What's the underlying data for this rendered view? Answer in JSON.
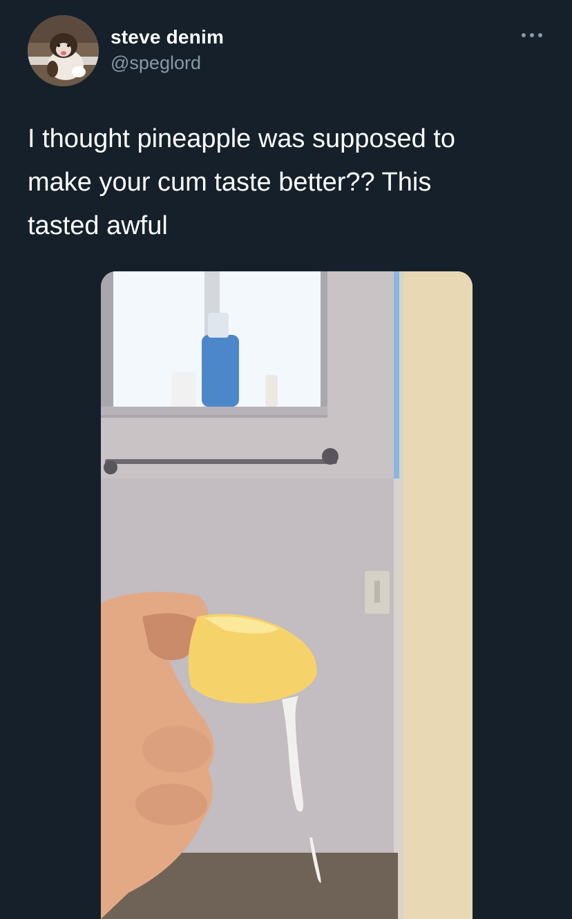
{
  "author": {
    "display_name": "steve denim",
    "handle": "@speglord",
    "avatar_icon": "dog-avatar-icon"
  },
  "tweet": {
    "text": "I thought pineapple was supposed to\nmake your cum taste better?? This\ntasted awful"
  },
  "menu": {
    "icon": "more-options-icon"
  },
  "media": {
    "icon": "photo-pineapple-bathroom"
  },
  "colors": {
    "background": "#15202b",
    "secondary_text": "#8899a6",
    "primary_text": "#ffffff"
  }
}
